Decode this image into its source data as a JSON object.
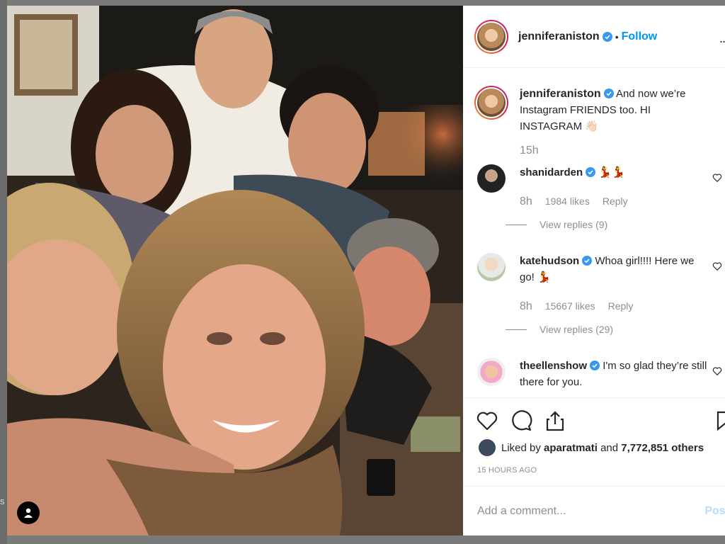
{
  "post": {
    "author": "jenniferaniston",
    "follow_label": "Follow",
    "separator": "•",
    "more_label": "...",
    "caption": "And now we’re Instagram FRIENDS too. HI INSTAGRAM 👋🏻",
    "caption_time": "15h",
    "liked_by_prefix": "Liked by",
    "liked_by_user": "aparatmati",
    "liked_by_and": "and",
    "liked_by_count": "7,772,851 others",
    "time_ago": "15 HOURS AGO",
    "add_comment_placeholder": "Add a comment...",
    "post_label": "Post"
  },
  "comments": [
    {
      "user": "shanidarden",
      "text": "💃💃",
      "time": "8h",
      "likes": "1984 likes",
      "reply": "Reply",
      "view_replies": "View replies (9)"
    },
    {
      "user": "katehudson",
      "text": "Whoa girl!!!! Here we go! 💃",
      "time": "8h",
      "likes": "15667 likes",
      "reply": "Reply",
      "view_replies": "View replies (29)"
    },
    {
      "user": "theellenshow",
      "text": "I'm so glad they’re still there for you."
    }
  ],
  "left_edge_text": "s",
  "colors": {
    "link": "#0095f6",
    "muted": "#8e8e8e",
    "text": "#262626",
    "verified": "#3897f0"
  },
  "icons": [
    "heart-icon",
    "comment-icon",
    "share-icon",
    "bookmark-icon",
    "verified-icon",
    "user-tag-icon"
  ]
}
